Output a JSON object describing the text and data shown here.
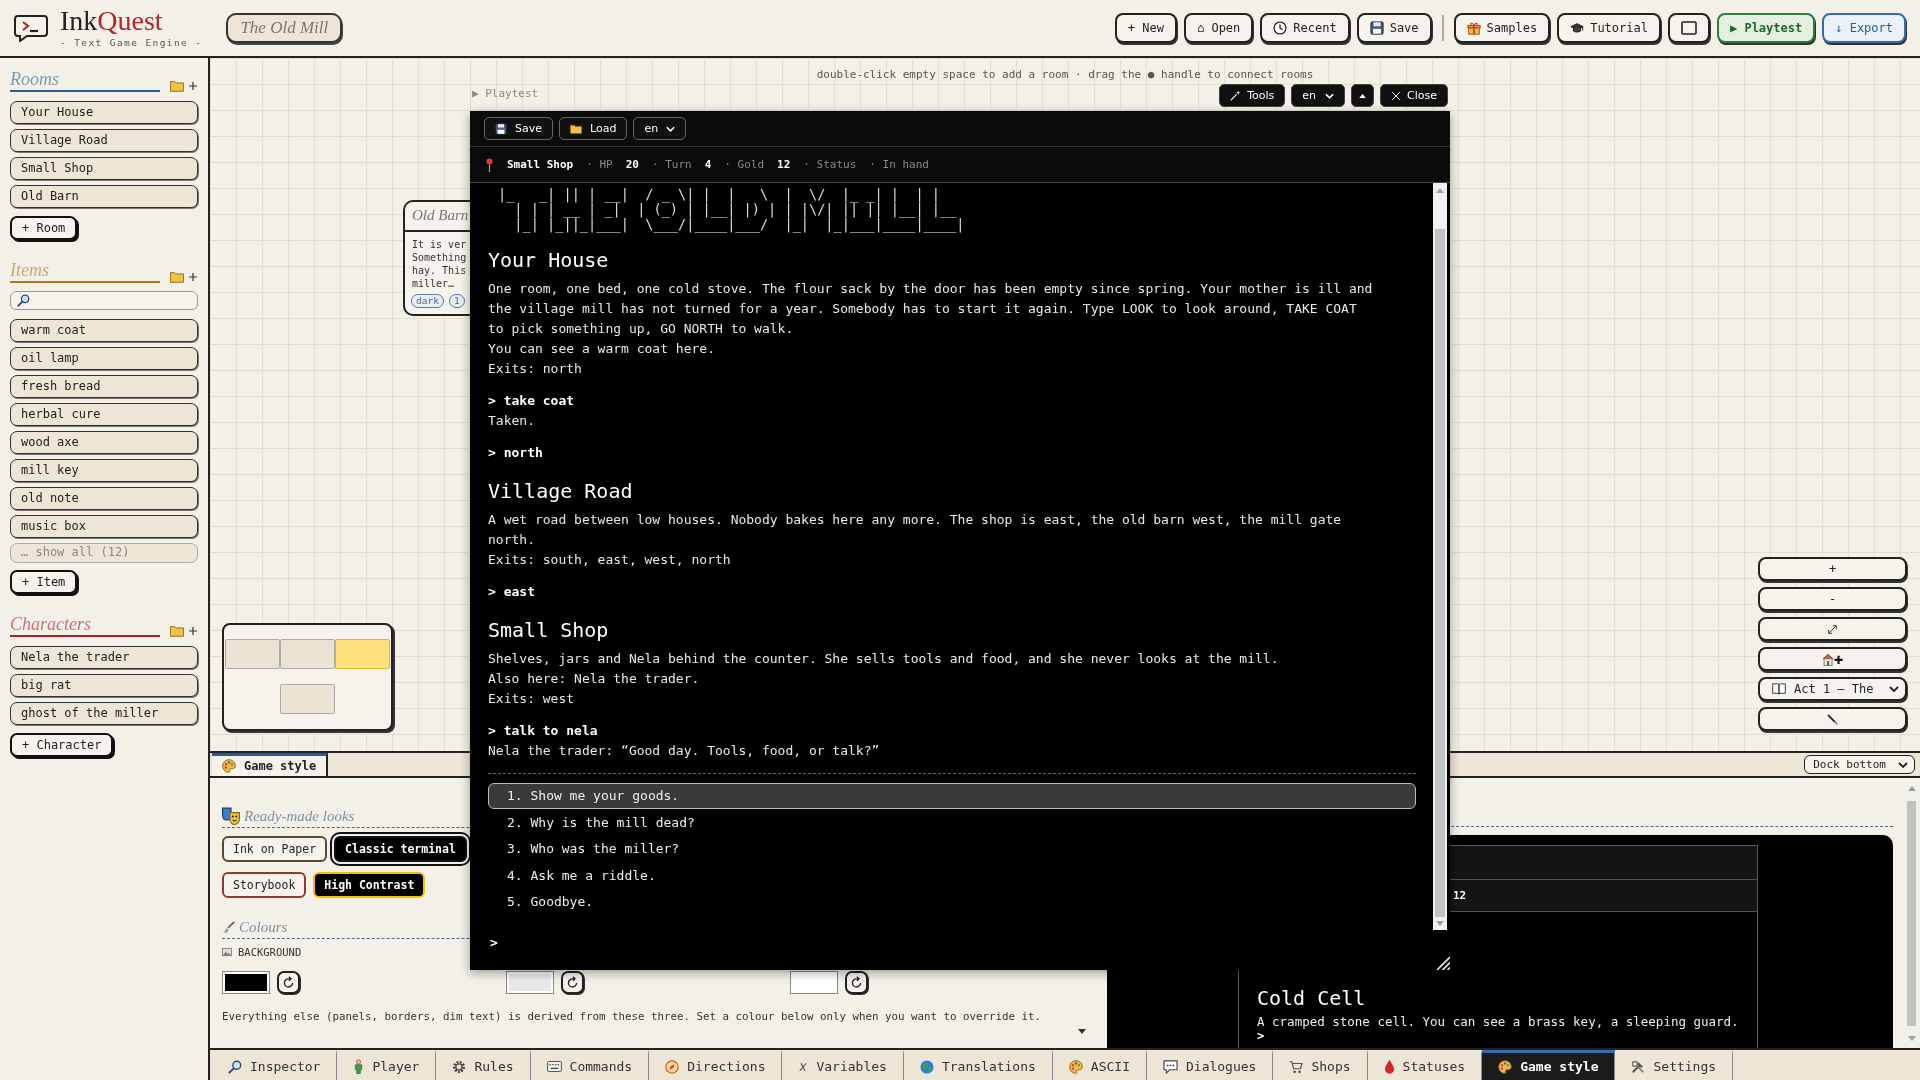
{
  "header": {
    "logo_first": "Ink",
    "logo_second": "Quest",
    "tagline": "- Text Game Engine -",
    "project": "The Old Mill",
    "file_buttons": [
      {
        "kind": "new",
        "label": "+ New"
      },
      {
        "kind": "open",
        "label": "⌂ Open"
      },
      {
        "kind": "recent",
        "label": "Recent"
      },
      {
        "kind": "save",
        "label": "Save"
      }
    ],
    "tool_buttons": [
      {
        "kind": "samples",
        "label": "Samples"
      },
      {
        "kind": "tutorial",
        "label": "Tutorial"
      },
      {
        "kind": "layout"
      },
      {
        "kind": "playtest",
        "label": "▶ Playtest"
      },
      {
        "kind": "export",
        "label": "↓ Export"
      }
    ]
  },
  "sidebar": {
    "sections": [
      {
        "title": "Rooms",
        "color": "#2f5d95",
        "searchable": false,
        "items": [
          {
            "label": "Your House",
            "selected": false
          },
          {
            "label": "Village Road",
            "selected": false
          },
          {
            "label": "Small Shop",
            "selected": false
          },
          {
            "label": "Old Barn",
            "selected": false
          }
        ],
        "add_label": "+ Room"
      },
      {
        "title": "Items",
        "color": "#b07a1c",
        "searchable": true,
        "items": [
          {
            "label": "warm coat",
            "selected": false
          },
          {
            "label": "oil lamp",
            "selected": false
          },
          {
            "label": "fresh bread",
            "selected": false
          },
          {
            "label": "herbal cure",
            "selected": false
          },
          {
            "label": "wood axe",
            "selected": false
          },
          {
            "label": "mill key",
            "selected": false
          },
          {
            "label": "old note",
            "selected": false
          },
          {
            "label": "music box",
            "selected": false
          }
        ],
        "show_more": "… show all (12)",
        "add_label": "+ Item"
      },
      {
        "title": "Characters",
        "color": "#a82424",
        "searchable": false,
        "items": [
          {
            "label": "Nela the trader",
            "selected": false
          },
          {
            "label": "big rat",
            "selected": false
          },
          {
            "label": "ghost of the miller",
            "selected": false
          }
        ],
        "add_label": "+ Character"
      }
    ]
  },
  "canvas": {
    "hint": "double-click empty space to add a room · drag the ● handle to connect rooms",
    "nodes": [
      {
        "title": "Old Barn",
        "text": "It is ver\nSomething\nhay. This\nmiller…",
        "tags": [
          "dark",
          "1"
        ]
      }
    ],
    "minimap": {
      "rows": [
        {
          "rooms": [
            {
              "selected": false
            },
            {
              "selected": false
            },
            {
              "selected": true
            }
          ]
        },
        {
          "rooms": [
            {
              "selected": false
            }
          ]
        }
      ]
    },
    "zoom_controls": [
      {
        "kind": "zoom_in",
        "label": "+"
      },
      {
        "kind": "zoom_out",
        "label": "-"
      },
      {
        "kind": "fit"
      },
      {
        "kind": "add_room"
      },
      {
        "kind": "chapter",
        "label": "Act 1 – The"
      },
      {
        "kind": "draw"
      }
    ]
  },
  "playtest": {
    "label": "▶ Playtest",
    "toolbar": [
      {
        "kind": "tools",
        "label": "Tools"
      },
      {
        "kind": "language",
        "label": "en"
      },
      {
        "kind": "collapse"
      },
      {
        "kind": "close",
        "label": "Close"
      }
    ],
    "controls": [
      {
        "kind": "save",
        "label": "Save"
      },
      {
        "kind": "load",
        "label": "Load"
      },
      {
        "kind": "language",
        "label": "en"
      }
    ],
    "status": {
      "location": "Small Shop",
      "stats": [
        {
          "label": "· HP",
          "value": "20"
        },
        {
          "label": "· Turn",
          "value": "4"
        },
        {
          "label": "· Gold",
          "value": "12"
        },
        {
          "label": "· Status"
        },
        {
          "label": "· In hand"
        }
      ]
    },
    "banner": [
      "|_   _| || | __|  / _ \\| |  |   \\  |  \\/  |_ _| |  | |",
      "  | | | __ | _|  | (_) | |__| |) | | |\\/| || || |__| |__",
      "  |_| |_||_|___|  \\___/|____|___/  |_|  |_|___|____|____|"
    ],
    "transcript": [
      {
        "kind": "heading",
        "text": "Your House"
      },
      {
        "kind": "text",
        "text": "One room, one bed, one cold stove. The flour sack by the door has been empty since spring. Your mother is ill and the village mill has not turned for a year. Somebody has to start it again. Type LOOK to look around, TAKE COAT to pick something up, GO NORTH to walk."
      },
      {
        "kind": "text",
        "text": "You can see a warm coat here."
      },
      {
        "kind": "text",
        "text": "Exits: north"
      },
      {
        "kind": "command",
        "text": "> take coat"
      },
      {
        "kind": "text",
        "text": "Taken."
      },
      {
        "kind": "command",
        "text": "> north"
      },
      {
        "kind": "heading",
        "text": "Village Road"
      },
      {
        "kind": "text",
        "text": "A wet road between low houses. Nobody bakes here any more. The shop is east, the old barn west, the mill gate north."
      },
      {
        "kind": "text",
        "text": "Exits: south, east, west, north"
      },
      {
        "kind": "command",
        "text": "> east"
      },
      {
        "kind": "heading",
        "text": "Small Shop"
      },
      {
        "kind": "text",
        "text": "Shelves, jars and Nela behind the counter. She sells tools and food, and she never looks at the mill."
      },
      {
        "kind": "text",
        "text": "Also here: Nela the trader."
      },
      {
        "kind": "text",
        "text": "Exits: west"
      },
      {
        "kind": "command",
        "text": "> talk to nela"
      },
      {
        "kind": "text",
        "text": "Nela the trader: “Good day. Tools, food, or talk?”"
      }
    ],
    "choices": [
      {
        "label": "1. Show me your goods.",
        "selected": true
      },
      {
        "label": "2. Why is the mill dead?",
        "selected": false
      },
      {
        "label": "3. Who was the miller?",
        "selected": false
      },
      {
        "label": "4. Ask me a riddle.",
        "selected": false
      },
      {
        "label": "5. Goodbye.",
        "selected": false
      }
    ],
    "prompt": ">"
  },
  "dock": {
    "tabs": [
      {
        "label": "Game style",
        "selected": true
      }
    ],
    "position": "Dock bottom",
    "looks": {
      "title": "Ready-made looks",
      "presets": [
        {
          "label": "Ink on Paper",
          "kind": "light",
          "color": "#5c4a2e",
          "selected": false
        },
        {
          "label": "Classic terminal",
          "kind": "dark",
          "color": "#111111",
          "selected": true
        },
        {
          "label": "Storybook",
          "kind": "light",
          "color": "#8c3b2c",
          "selected": false
        },
        {
          "label": "High Contrast",
          "kind": "dark",
          "color": "#f2c200",
          "selected": false
        }
      ]
    },
    "colours": {
      "title": "Colours",
      "swatches": [
        {
          "label": "BACKGROUND",
          "color": "#000000"
        },
        {
          "color": "#e9e9e9"
        },
        {
          "color": "#ffffff"
        }
      ],
      "note": "Everything else (panels, borders, dim text) is derived from these three. Set a colour below only when you want to override it."
    },
    "preview": {
      "stat_value": "12",
      "room": "Cold Cell",
      "text": "A cramped stone cell. You can see a brass key, a sleeping guard.",
      "prompt": ">"
    }
  },
  "bottom_tabs": [
    {
      "kind": "inspector",
      "label": "Inspector",
      "selected": false
    },
    {
      "kind": "player",
      "label": "Player",
      "selected": false
    },
    {
      "kind": "rules",
      "label": "Rules",
      "selected": false
    },
    {
      "kind": "commands",
      "label": "Commands",
      "selected": false
    },
    {
      "kind": "directions",
      "label": "Directions",
      "selected": false
    },
    {
      "kind": "variables",
      "label": "Variables",
      "selected": false
    },
    {
      "kind": "translations",
      "label": "Translations",
      "selected": false
    },
    {
      "kind": "ascii",
      "label": "ASCII",
      "selected": false
    },
    {
      "kind": "dialogues",
      "label": "Dialogues",
      "selected": false
    },
    {
      "kind": "shops",
      "label": "Shops",
      "selected": false
    },
    {
      "kind": "statuses",
      "label": "Statuses",
      "selected": false
    },
    {
      "kind": "game_style",
      "label": "Game style",
      "selected": true
    },
    {
      "kind": "settings",
      "label": "Settings",
      "selected": false
    }
  ]
}
